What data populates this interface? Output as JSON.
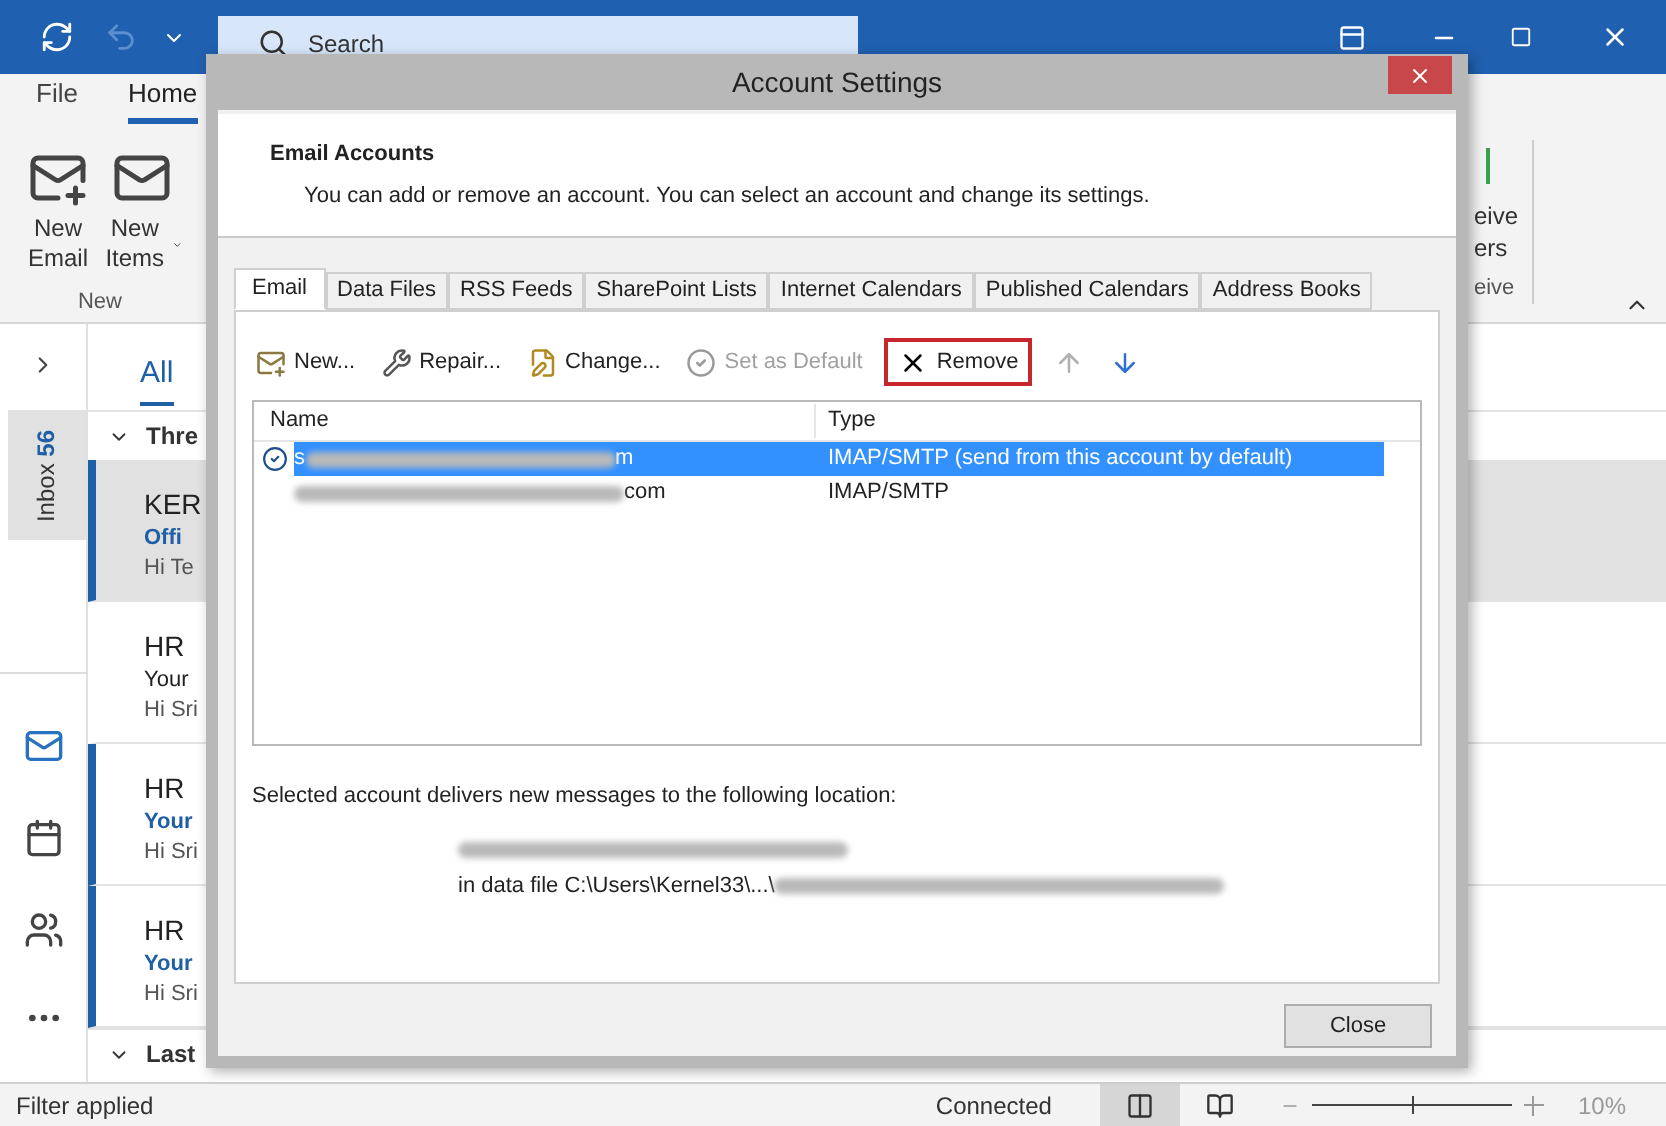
{
  "outlook": {
    "search": {
      "placeholder": "Search"
    },
    "ribbon_tabs": [
      {
        "label": "File",
        "selected": false
      },
      {
        "label": "Home",
        "selected": true
      }
    ],
    "ribbon_buttons": [
      {
        "kind": "mail",
        "label": "New Email"
      },
      {
        "kind": "items",
        "label": "New Items",
        "dropdown": true
      }
    ],
    "ribbon_group": "New",
    "ribbon_right": {
      "lines": [
        "eive",
        "ers"
      ],
      "group": "eive"
    },
    "nav_folder": {
      "label": "Inbox",
      "count": "56"
    },
    "filter_tab": "All",
    "groups": [
      {
        "label": "Thre",
        "messages": [
          {
            "sender": "KER",
            "subject": "Offi",
            "preview": "Hi Te",
            "selected": true,
            "unread": true
          },
          {
            "sender": "HR",
            "subject": "Your",
            "preview": "Hi Sri",
            "selected": false,
            "unread": false
          },
          {
            "sender": "HR",
            "subject": "Your",
            "preview": "Hi Sri",
            "selected": false,
            "unread": true
          },
          {
            "sender": "HR",
            "subject": "Your",
            "preview": "Hi Sri",
            "selected": false,
            "unread": true
          }
        ]
      },
      {
        "label": "Last"
      }
    ],
    "status_bar": {
      "left": "Filter applied",
      "connection": "Connected",
      "views": [
        {
          "kind": "normal",
          "selected": true
        },
        {
          "kind": "reading",
          "selected": false
        }
      ],
      "zoom": {
        "level": 0.5,
        "reading": "10%"
      }
    }
  },
  "dialog": {
    "title": "Account Settings",
    "heading": "Email Accounts",
    "description": "You can add or remove an account. You can select an account and change its settings.",
    "tabs": [
      {
        "label": "Email",
        "selected": true
      },
      {
        "label": "Data Files",
        "selected": false
      },
      {
        "label": "RSS Feeds",
        "selected": false
      },
      {
        "label": "SharePoint Lists",
        "selected": false
      },
      {
        "label": "Internet Calendars",
        "selected": false
      },
      {
        "label": "Published Calendars",
        "selected": false
      },
      {
        "label": "Address Books",
        "selected": false
      }
    ],
    "toolbar": [
      {
        "kind": "new",
        "label": "New...",
        "disabled": false,
        "highlighted": false
      },
      {
        "kind": "repair",
        "label": "Repair...",
        "disabled": false,
        "highlighted": false
      },
      {
        "kind": "change",
        "label": "Change...",
        "disabled": false,
        "highlighted": false
      },
      {
        "kind": "default",
        "label": "Set as Default",
        "disabled": true,
        "highlighted": false
      },
      {
        "kind": "remove",
        "label": "Remove",
        "disabled": false,
        "highlighted": true
      },
      {
        "kind": "up",
        "disabled": true,
        "highlighted": false
      },
      {
        "kind": "down",
        "disabled": false,
        "highlighted": false
      }
    ],
    "columns": [
      "Name",
      "Type"
    ],
    "rows": [
      {
        "name_start": "s",
        "name_end": "m",
        "type": "IMAP/SMTP (send from this account by default)",
        "selected": true,
        "default": true
      },
      {
        "name_start": "",
        "name_end": "com",
        "type": "IMAP/SMTP",
        "selected": false,
        "default": false
      }
    ],
    "location_label": "Selected account delivers new messages to the following location:",
    "data_file_prefix": "in data file C:\\Users\\Kernel33\\...\\",
    "close_button": "Close"
  }
}
